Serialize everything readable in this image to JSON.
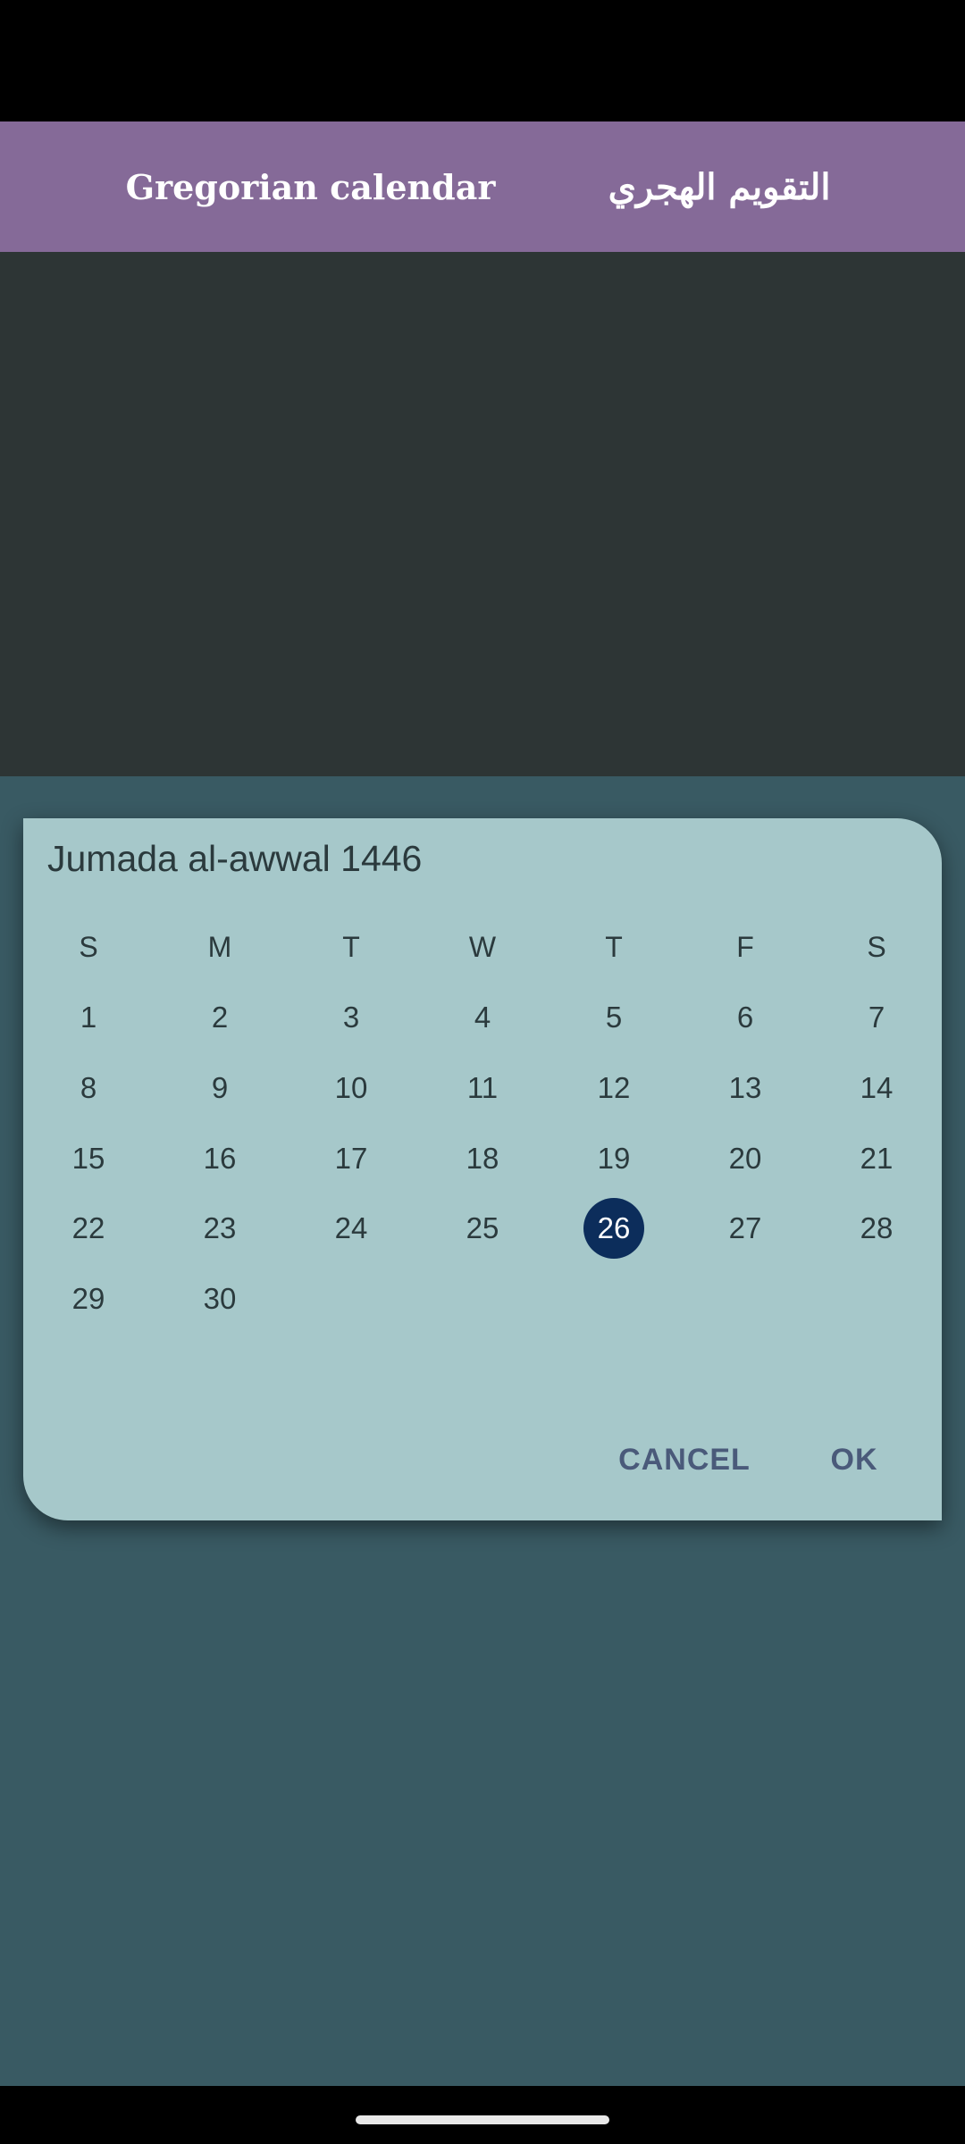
{
  "tabs": {
    "gregorian_label": "Gregorian calendar",
    "hijri_label": "التقويم الهجري"
  },
  "dialog": {
    "title": "Jumada al-awwal 1446",
    "weekdays": [
      "S",
      "M",
      "T",
      "W",
      "T",
      "F",
      "S"
    ],
    "weeks": [
      [
        "1",
        "2",
        "3",
        "4",
        "5",
        "6",
        "7"
      ],
      [
        "8",
        "9",
        "10",
        "11",
        "12",
        "13",
        "14"
      ],
      [
        "15",
        "16",
        "17",
        "18",
        "19",
        "20",
        "21"
      ],
      [
        "22",
        "23",
        "24",
        "25",
        "26",
        "27",
        "28"
      ],
      [
        "29",
        "30"
      ]
    ],
    "selected_day": "26",
    "cancel_label": "CANCEL",
    "ok_label": "OK"
  },
  "colors": {
    "tab_bar": "#856a98",
    "dialog_background": "#a6c8ca",
    "selected_day": "#0c2d5b",
    "button_text": "#4a5a7a"
  }
}
